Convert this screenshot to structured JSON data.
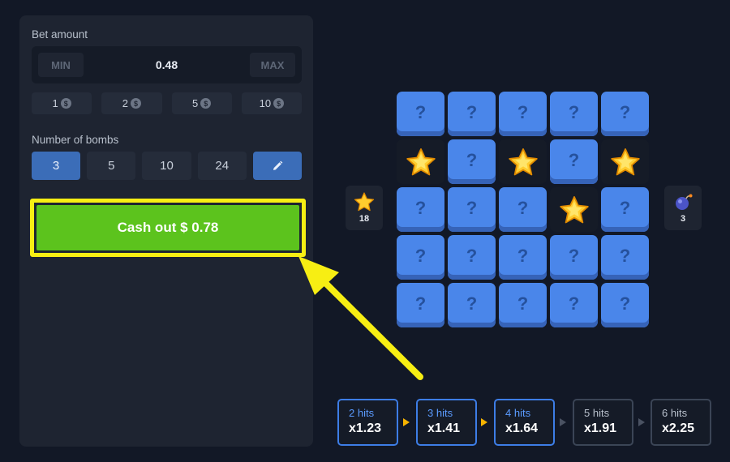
{
  "bet": {
    "label": "Bet amount",
    "min_label": "MIN",
    "max_label": "MAX",
    "value": "0.48",
    "chips": [
      "1",
      "2",
      "5",
      "10"
    ],
    "coin_symbol": "$"
  },
  "bombs": {
    "label": "Number of bombs",
    "options": [
      "3",
      "5",
      "10",
      "24"
    ],
    "selected": "3"
  },
  "cashout": {
    "label": "Cash out $ 0.78"
  },
  "board": {
    "hidden_symbol": "?",
    "tiles": [
      [
        "hidden",
        "hidden",
        "hidden",
        "hidden",
        "hidden"
      ],
      [
        "star",
        "hidden",
        "star",
        "hidden",
        "star"
      ],
      [
        "hidden",
        "hidden",
        "hidden",
        "star",
        "hidden"
      ],
      [
        "hidden",
        "hidden",
        "hidden",
        "hidden",
        "hidden"
      ],
      [
        "hidden",
        "hidden",
        "hidden",
        "hidden",
        "hidden"
      ]
    ]
  },
  "counters": {
    "stars": "18",
    "bombs": "3"
  },
  "multipliers": [
    {
      "hits": "2 hits",
      "value": "x1.23",
      "active": true
    },
    {
      "hits": "3 hits",
      "value": "x1.41",
      "active": true
    },
    {
      "hits": "4 hits",
      "value": "x1.64",
      "active": true
    },
    {
      "hits": "5 hits",
      "value": "x1.91",
      "active": false
    },
    {
      "hits": "6 hits",
      "value": "x2.25",
      "active": false
    }
  ],
  "colors": {
    "accent_blue": "#3b6db8",
    "cashout_green": "#5cc31d",
    "highlight_yellow": "#f7ee13",
    "tile_blue": "#4a86ea"
  }
}
